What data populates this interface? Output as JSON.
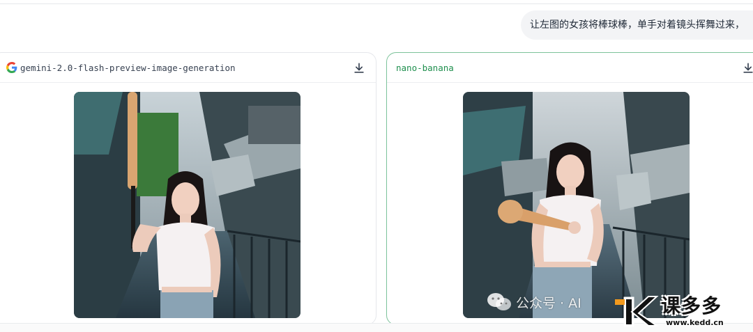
{
  "prompt": {
    "text": "让左图的女孩将棒球棒，单手对着镜头挥舞过来，"
  },
  "cards": [
    {
      "model": "gemini-2.0-flash-preview-image-generation",
      "icon": "google-g-icon",
      "download_icon": "download-icon",
      "image_alt": "Girl in white tank top and denim shorts holding a baseball bat upright on a stairway between old buildings"
    },
    {
      "model": "nano-banana",
      "icon": "",
      "download_icon": "download-icon",
      "image_alt": "Girl in white tank top swinging a baseball bat toward the camera on a stairway between old buildings"
    }
  ],
  "watermark": {
    "text": "公众号 · AI",
    "icon": "wechat-icon"
  },
  "brand": {
    "name": "课多多",
    "url": "www.kedd.cn"
  },
  "colors": {
    "accent_green": "#1f8f4e",
    "selected_border": "#7cc29a",
    "brand_orange": "#f39a1e"
  }
}
